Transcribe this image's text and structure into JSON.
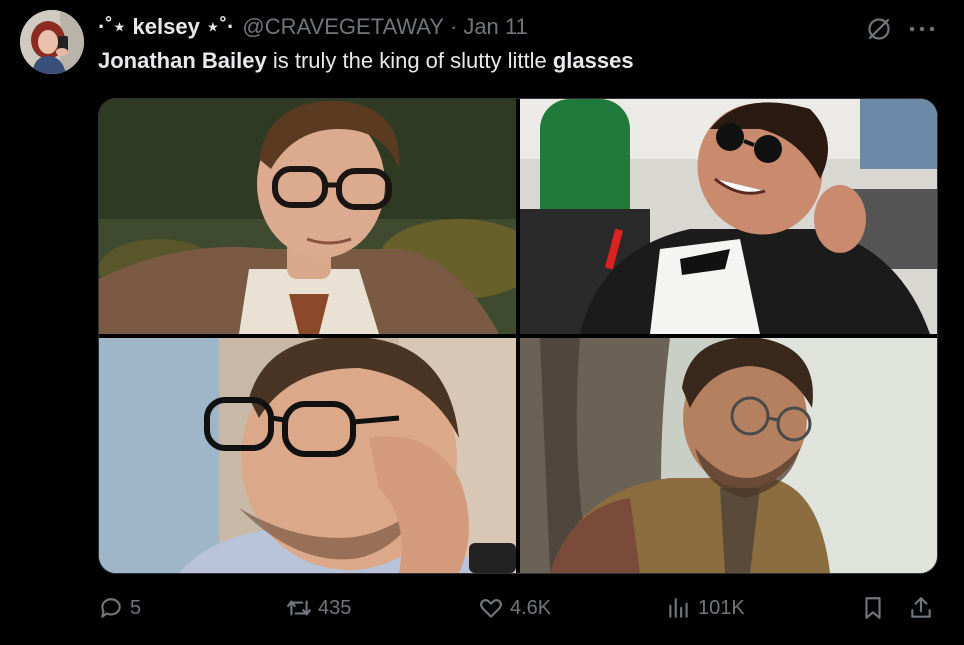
{
  "tweet": {
    "author": {
      "display_name": "·˚⋆ kelsey ⋆˚·",
      "handle": "@CRAVEGETAWAY",
      "separator": "·",
      "date": "Jan 11",
      "avatar_icon": "user-avatar"
    },
    "text": {
      "part1": "Jonathan Bailey",
      "part2": " is truly the king of slutty little ",
      "part3": "glasses"
    },
    "icons": {
      "grok": "grok-icon",
      "more": "more-icon"
    },
    "media": [
      {
        "icon": "photo-1"
      },
      {
        "icon": "photo-2"
      },
      {
        "icon": "photo-3"
      },
      {
        "icon": "photo-4"
      }
    ],
    "actions": {
      "replies": "5",
      "reposts": "435",
      "likes": "4.6K",
      "views": "101K"
    }
  },
  "colors": {
    "background": "#000000",
    "text_primary": "#e7e9ea",
    "text_secondary": "#71767b",
    "border": "#2f3336"
  }
}
